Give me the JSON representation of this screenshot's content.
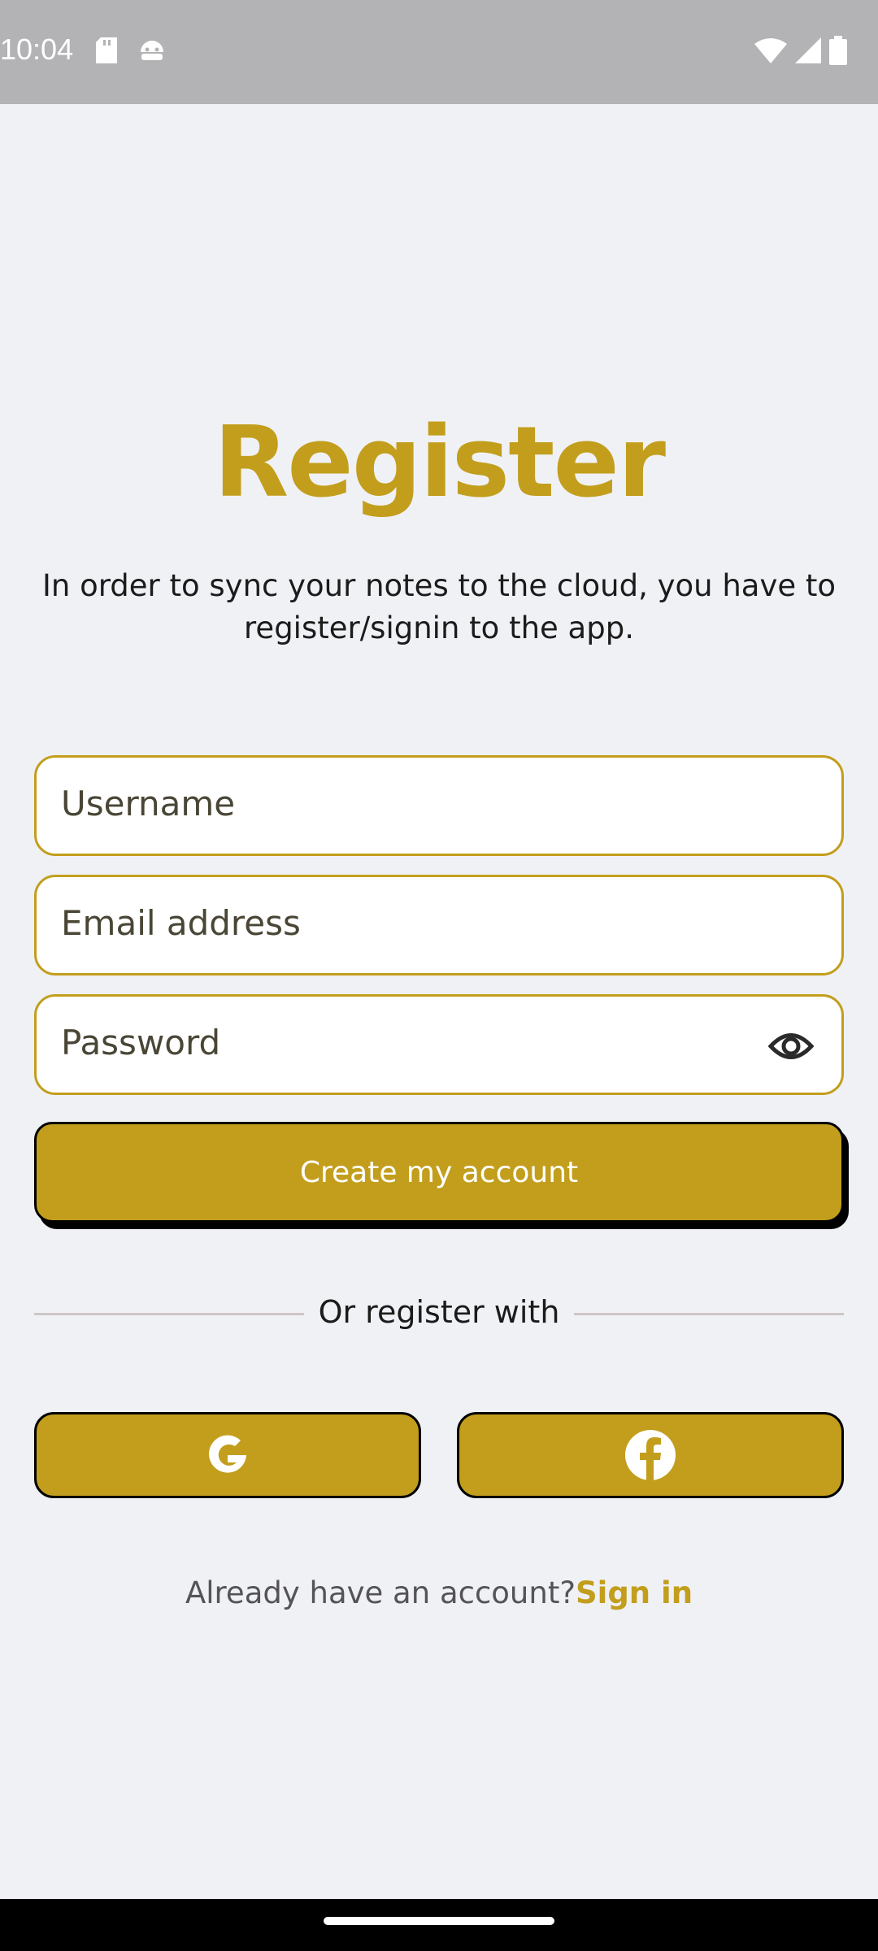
{
  "status_bar": {
    "time": "10:04",
    "left_icons": [
      "sd-card-icon",
      "android-icon"
    ],
    "right_icons": [
      "wifi-icon",
      "signal-icon",
      "battery-icon"
    ]
  },
  "header": {
    "title": "Register",
    "subtitle": "In order to sync your notes to the cloud, you have to register/signin to the app."
  },
  "form": {
    "username_placeholder": "Username",
    "email_placeholder": "Email address",
    "password_placeholder": "Password",
    "submit_label": "Create my account"
  },
  "social": {
    "divider_text": "Or register with",
    "buttons": [
      "google-icon",
      "facebook-icon"
    ]
  },
  "footer": {
    "prompt": "Already have an account?",
    "link": "Sign in"
  },
  "colors": {
    "accent": "#C29E1C",
    "background": "#F0F1F5",
    "status_bar": "#B3B3B5"
  }
}
